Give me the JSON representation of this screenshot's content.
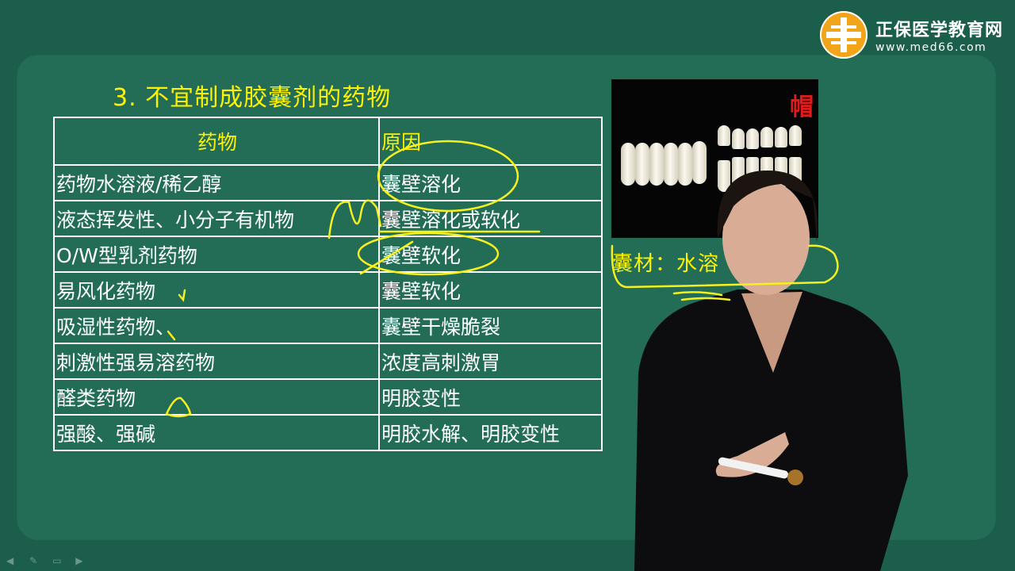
{
  "brand": {
    "name": "正保医学教育网",
    "url": "www.med66.com",
    "logo_icon": "cross-circle-logo",
    "accent": "#f3a51a"
  },
  "slide": {
    "title": "3. 不宜制成胶囊剂的药物",
    "table": {
      "headers": [
        "药物",
        "原因"
      ],
      "rows": [
        [
          "药物水溶液/稀乙醇",
          "囊壁溶化"
        ],
        [
          "液态挥发性、小分子有机物",
          "囊壁溶化或软化"
        ],
        [
          "O/W型乳剂药物",
          "囊壁软化"
        ],
        [
          "易风化药物",
          "囊壁软化"
        ],
        [
          "吸湿性药物、",
          "囊壁干燥脆裂"
        ],
        [
          "刺激性强易溶药物",
          "浓度高刺激胃"
        ],
        [
          "醛类药物",
          "明胶变性"
        ],
        [
          "强酸、强碱",
          "明胶水解、明胶变性"
        ]
      ]
    },
    "photo_label": "帽",
    "shell_note": "囊材：水溶",
    "colors": {
      "background": "#1b5e4b",
      "panel": "#236d57",
      "title": "#fff200",
      "text": "#ffffff",
      "annotation": "#f5f01e"
    }
  },
  "toolbar": {
    "icons": [
      "arrow-left-icon",
      "pen-icon",
      "screen-icon",
      "arrow-right-icon"
    ]
  }
}
